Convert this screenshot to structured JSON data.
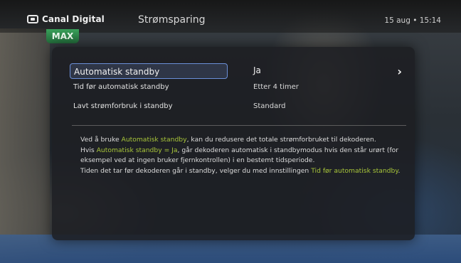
{
  "header": {
    "brand": "Canal Digital",
    "title": "Strømsparing",
    "datetime": "15 aug • 15:14",
    "badge": "MAX"
  },
  "settings": [
    {
      "label": "Automatisk standby",
      "value": "Ja",
      "selected": true
    },
    {
      "label": "Tid før automatisk standby",
      "value": "Etter 4 timer"
    },
    {
      "label": "Lavt strømforbruk i standby",
      "value": "Standard"
    }
  ],
  "description": {
    "p1_a": "Ved å bruke ",
    "p1_hl": "Automatisk standby",
    "p1_b": ", kan du redusere det totale strømforbruket til dekoderen.",
    "p2_a": "Hvis ",
    "p2_hl": "Automatisk standby = Ja",
    "p2_b": ", går dekoderen automatisk i standbymodus hvis den står urørt (for eksempel ved at ingen bruker fjernkontrollen) i en bestemt tidsperiode.",
    "p3_a": "Tiden det tar før dekoderen går i standby, velger du med innstillingen ",
    "p3_hl": "Tid før automatisk standby",
    "p3_b": "."
  },
  "colors": {
    "highlight": "#a8c53a",
    "selection": "#6b8fd8",
    "badge": "#3aa05a"
  },
  "icons": {
    "logo": "tv-logo-icon",
    "selected_arrow": "chevron-right-icon"
  }
}
